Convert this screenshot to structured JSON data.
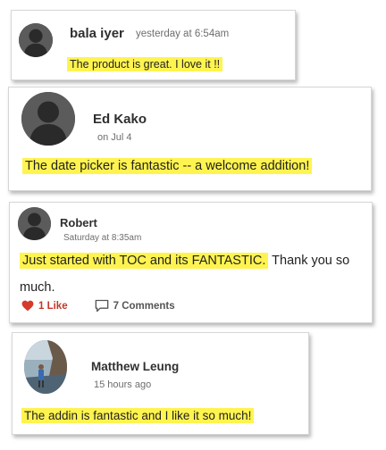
{
  "comments": [
    {
      "author": "bala iyer",
      "time": "yesterday at 6:54am",
      "message": "The product is great. I love it !!"
    },
    {
      "author": "Ed Kako",
      "time": "on Jul 4",
      "message": "The date picker is fantastic -- a welcome addition!"
    },
    {
      "author": "Robert",
      "time": "Saturday at 8:35am",
      "message_highlighted": "Just started with TOC and its FANTASTIC.",
      "message_rest": " Thank you so much.",
      "like_label": "1 Like",
      "comments_label": "7 Comments"
    },
    {
      "author": "Matthew Leung",
      "time": "15 hours ago",
      "message": "The addin is fantastic and I like it so much!"
    }
  ],
  "colors": {
    "highlight": "#fff44f",
    "like": "#c0392b",
    "avatar_placeholder": "#5b5b5b"
  },
  "icons": {
    "default_avatar": "user-silhouette-icon",
    "like": "heart-icon",
    "comments": "speech-bubble-icon"
  }
}
